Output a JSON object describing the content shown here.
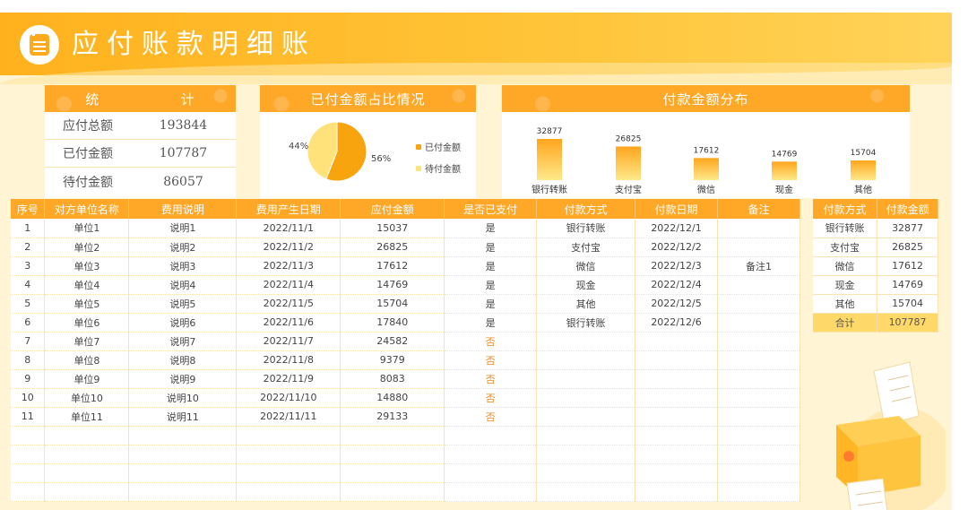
{
  "title": "应付账款明细账",
  "stats": {
    "header": [
      "统",
      "计"
    ],
    "rows": [
      {
        "label": "应付总额",
        "value": "193844"
      },
      {
        "label": "已付金额",
        "value": "107787"
      },
      {
        "label": "待付金额",
        "value": "86057"
      }
    ]
  },
  "pie_card": {
    "title": "已付金额占比情况",
    "label_left": "44%",
    "label_right": "56%",
    "legend": [
      "已付金额",
      "待付金额"
    ]
  },
  "bar_card": {
    "title": "付款金额分布"
  },
  "colors": {
    "accent": "#ffa726",
    "paid": "#f7a40f",
    "unpaid": "#ffe27a",
    "no_text": "#ee8a1f"
  },
  "chart_data": [
    {
      "type": "pie",
      "categories": [
        "已付金额",
        "待付金额"
      ],
      "values": [
        56,
        44
      ],
      "title": "已付金额占比情况"
    },
    {
      "type": "bar",
      "categories": [
        "银行转账",
        "支付宝",
        "微信",
        "现金",
        "其他"
      ],
      "values": [
        32877,
        26825,
        17612,
        14769,
        15704
      ],
      "title": "付款金额分布"
    }
  ],
  "main_table": {
    "headers": [
      "序号",
      "对方单位名称",
      "费用说明",
      "费用产生日期",
      "应付金额",
      "是否已支付",
      "付款方式",
      "付款日期",
      "备注"
    ],
    "rows": [
      [
        "1",
        "单位1",
        "说明1",
        "2022/11/1",
        "15037",
        "是",
        "银行转账",
        "2022/12/1",
        ""
      ],
      [
        "2",
        "单位2",
        "说明2",
        "2022/11/2",
        "26825",
        "是",
        "支付宝",
        "2022/12/2",
        ""
      ],
      [
        "3",
        "单位3",
        "说明3",
        "2022/11/3",
        "17612",
        "是",
        "微信",
        "2022/12/3",
        "备注1"
      ],
      [
        "4",
        "单位4",
        "说明4",
        "2022/11/4",
        "14769",
        "是",
        "现金",
        "2022/12/4",
        ""
      ],
      [
        "5",
        "单位5",
        "说明5",
        "2022/11/5",
        "15704",
        "是",
        "其他",
        "2022/12/5",
        ""
      ],
      [
        "6",
        "单位6",
        "说明6",
        "2022/11/6",
        "17840",
        "是",
        "银行转账",
        "2022/12/6",
        ""
      ],
      [
        "7",
        "单位7",
        "说明7",
        "2022/11/7",
        "24582",
        "否",
        "",
        "",
        ""
      ],
      [
        "8",
        "单位8",
        "说明8",
        "2022/11/8",
        "9379",
        "否",
        "",
        "",
        ""
      ],
      [
        "9",
        "单位9",
        "说明9",
        "2022/11/9",
        "8083",
        "否",
        "",
        "",
        ""
      ],
      [
        "10",
        "单位10",
        "说明10",
        "2022/11/10",
        "14880",
        "否",
        "",
        "",
        ""
      ],
      [
        "11",
        "单位11",
        "说明11",
        "2022/11/11",
        "29133",
        "否",
        "",
        "",
        ""
      ]
    ]
  },
  "side_table": {
    "headers": [
      "付款方式",
      "付款金额"
    ],
    "rows": [
      [
        "银行转账",
        "32877"
      ],
      [
        "支付宝",
        "26825"
      ],
      [
        "微信",
        "17612"
      ],
      [
        "现金",
        "14769"
      ],
      [
        "其他",
        "15704"
      ]
    ],
    "total": [
      "合计",
      "107787"
    ]
  },
  "icons": {
    "title_icon": "notepad-icon",
    "decoration": "receipt-printer-illustration"
  }
}
